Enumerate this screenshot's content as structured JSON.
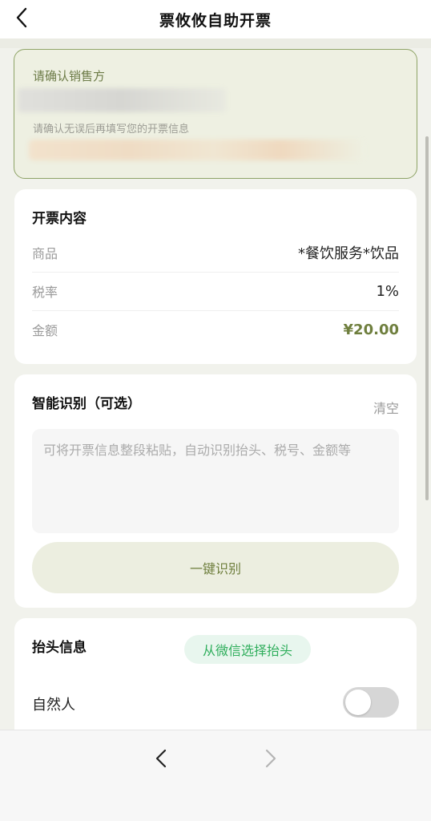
{
  "header": {
    "title": "票攸攸自助开票",
    "back_icon": "chevron-left-icon"
  },
  "seller": {
    "title": "请确认销售方",
    "hint": "请确认无误后再填写您的开票信息"
  },
  "invoice_content": {
    "title": "开票内容",
    "rows": [
      {
        "label": "商品",
        "value": "*餐饮服务*饮品"
      },
      {
        "label": "税率",
        "value": "1%"
      },
      {
        "label": "金额",
        "value": "¥20.00"
      }
    ]
  },
  "smart_recognition": {
    "title": "智能识别（可选）",
    "clear_label": "清空",
    "placeholder": "可将开票信息整段粘贴，自动识别抬头、税号、金额等",
    "button_label": "一键识别"
  },
  "header_info": {
    "title": "抬头信息",
    "wechat_button": "从微信选择抬头",
    "natural_person_label": "自然人",
    "natural_person_on": false
  },
  "colors": {
    "accent": "#6f7f3e",
    "seller_border": "#8ea366",
    "wechat_green": "#2fae5c"
  },
  "bottom_nav": {
    "back_icon": "chevron-left-icon",
    "forward_icon": "chevron-right-icon"
  }
}
